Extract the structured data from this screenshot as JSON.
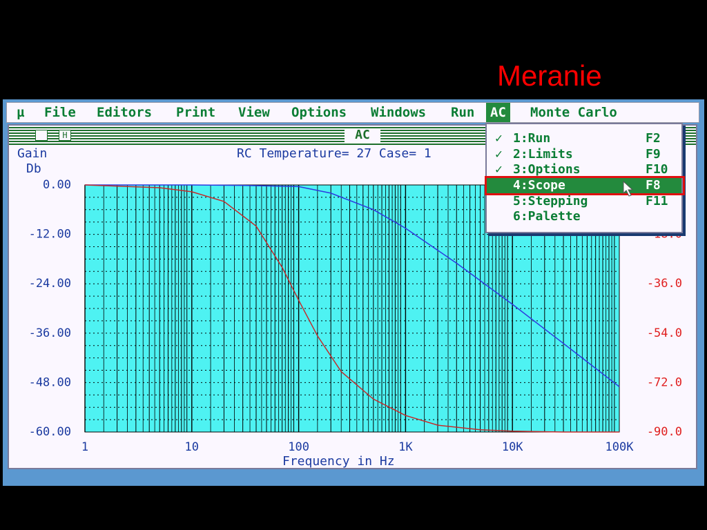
{
  "slide": {
    "title": "Meranie"
  },
  "menubar": {
    "items": [
      {
        "label": "µ",
        "left": 14
      },
      {
        "label": "File",
        "left": 54
      },
      {
        "label": "Editors",
        "left": 130
      },
      {
        "label": "Print",
        "left": 245
      },
      {
        "label": "View",
        "left": 335
      },
      {
        "label": "Options",
        "left": 412
      },
      {
        "label": "Windows",
        "left": 527
      },
      {
        "label": "Run",
        "left": 643
      },
      {
        "label": "AC",
        "left": 694,
        "active": true
      },
      {
        "label": "Monte Carlo",
        "left": 758
      }
    ]
  },
  "window": {
    "title": "AC",
    "header": "RC Temperature= 27 Case= 1",
    "y_label_line1": "Gain",
    "y_label_line2": "Db",
    "x_label": "Frequency in Hz"
  },
  "dropdown": {
    "items": [
      {
        "check": "✓",
        "label": "1:Run",
        "key": "F2",
        "selected": false
      },
      {
        "check": "✓",
        "label": "2:Limits",
        "key": "F9",
        "selected": false
      },
      {
        "check": "✓",
        "label": "3:Options",
        "key": "F10",
        "selected": false
      },
      {
        "check": "",
        "label": "4:Scope",
        "key": "F8",
        "selected": true
      },
      {
        "check": "",
        "label": "5:Stepping",
        "key": "F11",
        "selected": false
      },
      {
        "check": "",
        "label": "6:Palette",
        "key": "",
        "selected": false
      }
    ]
  },
  "chart_data": {
    "type": "line",
    "xlabel": "Frequency in Hz",
    "x_scale": "log",
    "xlim": [
      1,
      100000
    ],
    "x_ticks": [
      "1",
      "10",
      "100",
      "1K",
      "10K",
      "100K"
    ],
    "y_left_ticks": [
      "0.00",
      "-12.00",
      "-24.00",
      "-36.00",
      "-48.00",
      "-60.00"
    ],
    "y_right_ticks": [
      "18.0",
      "-36.0",
      "-54.0",
      "-72.0",
      "-90.0"
    ],
    "ylim_left": [
      -60,
      0
    ],
    "ylim_right": [
      -90,
      0
    ],
    "plot_bg": "#4ef2f2",
    "series": [
      {
        "axis": "left",
        "color": "#2d3adf",
        "x": [
          1,
          10,
          30,
          100,
          200,
          500,
          1000,
          3000,
          10000,
          30000,
          100000
        ],
        "y": [
          0,
          0,
          -0.1,
          -0.4,
          -2.0,
          -6.0,
          -10.5,
          -19.0,
          -29.0,
          -38.5,
          -49.0
        ]
      },
      {
        "axis": "right",
        "color": "#c42b2b",
        "x": [
          1,
          5,
          10,
          20,
          40,
          70,
          100,
          150,
          250,
          500,
          1000,
          2000,
          5000,
          10000,
          30000,
          100000
        ],
        "y": [
          0,
          -1,
          -2.5,
          -6,
          -15,
          -30,
          -42,
          -55,
          -68,
          -78,
          -84,
          -87.5,
          -89.2,
          -89.7,
          -90,
          -90
        ]
      }
    ]
  }
}
